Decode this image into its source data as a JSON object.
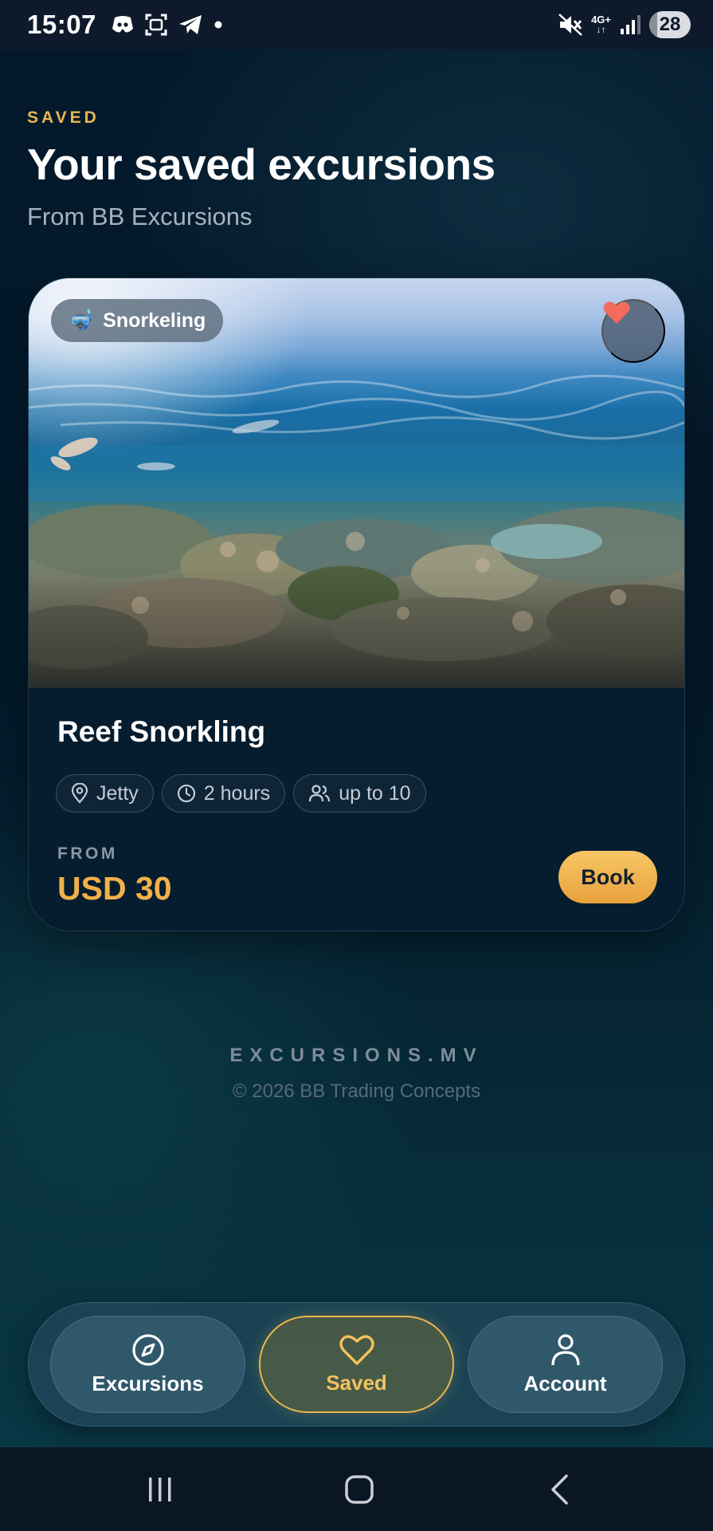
{
  "status_bar": {
    "time": "15:07",
    "network": "4G+",
    "battery": "28",
    "left_icons": [
      "discord-icon",
      "screen-capture-icon",
      "telegram-icon",
      "dot-icon"
    ],
    "right_icons": [
      "mute-icon",
      "network-4g-icon",
      "signal-icon",
      "battery-icon"
    ]
  },
  "header": {
    "eyebrow": "SAVED",
    "title": "Your saved excursions",
    "subtitle": "From BB Excursions"
  },
  "card": {
    "category_emoji": "🤿",
    "category": "Snorkeling",
    "favorite_icon": "heart-filled-icon",
    "favorited": true,
    "title": "Reef Snorkling",
    "meta": [
      {
        "icon": "location-pin-icon",
        "label": "Jetty"
      },
      {
        "icon": "clock-icon",
        "label": "2 hours"
      },
      {
        "icon": "users-icon",
        "label": "up to 10"
      }
    ],
    "price_label": "FROM",
    "price": "USD 30",
    "book_label": "Book"
  },
  "footer": {
    "brand": "EXCURSIONS.MV",
    "copyright": "© 2026 BB Trading Concepts"
  },
  "bottom_nav": {
    "items": [
      {
        "icon": "compass-icon",
        "label": "Excursions",
        "active": false
      },
      {
        "icon": "heart-outline-icon",
        "label": "Saved",
        "active": true
      },
      {
        "icon": "user-icon",
        "label": "Account",
        "active": false
      }
    ]
  },
  "system_nav": [
    "recents-icon",
    "home-icon",
    "back-icon"
  ],
  "colors": {
    "accent": "#e9b64f",
    "price": "#f1b04a",
    "background": "#04182a",
    "favorite": "#f26b5b"
  }
}
